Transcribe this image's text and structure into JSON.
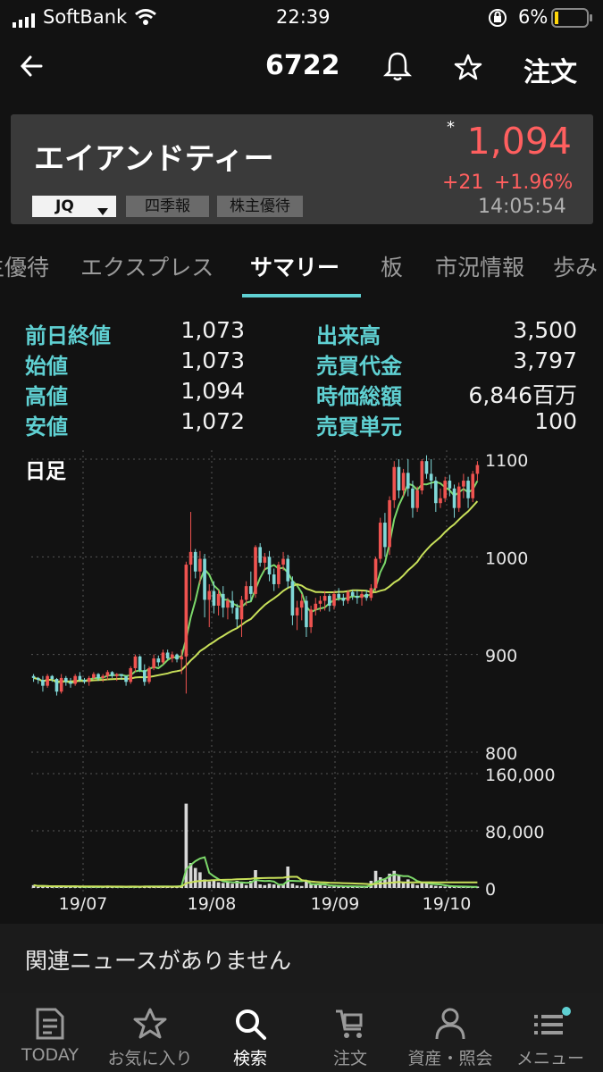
{
  "status_bar": {
    "carrier": "SoftBank",
    "time": "22:39",
    "battery": "6%"
  },
  "nav": {
    "back_icon": "arrow-left-icon",
    "title": "6722",
    "bell_icon": "bell-icon",
    "star_icon": "star-icon",
    "order_label": "注文"
  },
  "quote": {
    "name": "エイアンドティー",
    "asterisk": "*",
    "price": "1,094",
    "change": "+21",
    "change_pct": "+1.96%",
    "time": "14:05:54",
    "market": "JQ",
    "tags": [
      "四季報",
      "株主優待"
    ],
    "price_color": "#ff5f5f"
  },
  "tabs": [
    "主優待",
    "エクスプレス",
    "サマリー",
    "板",
    "市況情報",
    "歩み"
  ],
  "active_tab": "サマリー",
  "stats": {
    "left": [
      {
        "label": "前日終値",
        "value": "1,073"
      },
      {
        "label": "始値",
        "value": "1,073"
      },
      {
        "label": "高値",
        "value": "1,094"
      },
      {
        "label": "安値",
        "value": "1,072"
      }
    ],
    "right": [
      {
        "label": "出来高",
        "value": "3,500"
      },
      {
        "label": "売買代金",
        "value": "3,797"
      },
      {
        "label": "時価総額",
        "value": "6,846百万"
      },
      {
        "label": "売買単元",
        "value": "100"
      }
    ]
  },
  "chart_data": {
    "type": "candlestick",
    "period_label": "日足",
    "price_axis": {
      "ticks": [
        "1100",
        "1000",
        "900",
        "800"
      ],
      "ylim": [
        800,
        1100
      ]
    },
    "volume_axis": {
      "ticks": [
        "160,000",
        "80,000",
        "0"
      ],
      "ylim": [
        0,
        160000
      ]
    },
    "x_ticks": [
      "19/07",
      "19/08",
      "19/09",
      "19/10"
    ],
    "colors": {
      "up": "#ef5350",
      "down": "#80d8d8",
      "ma_short": "#7cd86a",
      "ma_mid": "#c8e05a",
      "ma_long": "#e070c0"
    },
    "candles": [
      [
        878,
        880,
        872,
        876
      ],
      [
        876,
        877,
        870,
        874
      ],
      [
        874,
        878,
        862,
        868
      ],
      [
        868,
        880,
        866,
        878
      ],
      [
        878,
        879,
        872,
        875
      ],
      [
        875,
        876,
        858,
        862
      ],
      [
        862,
        880,
        860,
        876
      ],
      [
        876,
        878,
        868,
        872
      ],
      [
        872,
        876,
        866,
        870
      ],
      [
        870,
        880,
        868,
        878
      ],
      [
        878,
        882,
        872,
        874
      ],
      [
        874,
        876,
        870,
        872
      ],
      [
        872,
        878,
        868,
        876
      ],
      [
        876,
        882,
        874,
        880
      ],
      [
        880,
        881,
        873,
        876
      ],
      [
        876,
        880,
        872,
        878
      ],
      [
        878,
        884,
        874,
        882
      ],
      [
        882,
        883,
        876,
        878
      ],
      [
        878,
        881,
        873,
        880
      ],
      [
        880,
        879,
        874,
        878
      ],
      [
        878,
        876,
        868,
        872
      ],
      [
        872,
        888,
        870,
        886
      ],
      [
        886,
        900,
        882,
        898
      ],
      [
        898,
        899,
        882,
        884
      ],
      [
        884,
        890,
        868,
        872
      ],
      [
        872,
        888,
        870,
        886
      ],
      [
        886,
        900,
        884,
        896
      ],
      [
        896,
        899,
        888,
        892
      ],
      [
        892,
        905,
        890,
        902
      ],
      [
        902,
        905,
        895,
        896
      ],
      [
        896,
        903,
        892,
        900
      ],
      [
        900,
        901,
        892,
        895
      ],
      [
        895,
        905,
        880,
        898
      ],
      [
        898,
        995,
        860,
        992
      ],
      [
        992,
        1046,
        955,
        1005
      ],
      [
        1005,
        1008,
        978,
        985
      ],
      [
        985,
        1006,
        972,
        998
      ],
      [
        998,
        1003,
        938,
        956
      ],
      [
        956,
        972,
        928,
        965
      ],
      [
        965,
        975,
        942,
        950
      ],
      [
        950,
        966,
        940,
        962
      ],
      [
        962,
        970,
        938,
        948
      ],
      [
        948,
        958,
        936,
        955
      ],
      [
        955,
        965,
        942,
        948
      ],
      [
        948,
        952,
        928,
        936
      ],
      [
        936,
        960,
        918,
        956
      ],
      [
        956,
        975,
        950,
        970
      ],
      [
        970,
        985,
        955,
        962
      ],
      [
        962,
        1012,
        958,
        1010
      ],
      [
        1010,
        1014,
        990,
        994
      ],
      [
        994,
        1004,
        986,
        1000
      ],
      [
        1000,
        1006,
        975,
        982
      ],
      [
        982,
        988,
        965,
        972
      ],
      [
        972,
        995,
        968,
        992
      ],
      [
        992,
        1005,
        986,
        998
      ],
      [
        998,
        1002,
        968,
        975
      ],
      [
        975,
        980,
        930,
        940
      ],
      [
        940,
        955,
        925,
        948
      ],
      [
        948,
        962,
        935,
        955
      ],
      [
        955,
        960,
        918,
        928
      ],
      [
        928,
        950,
        922,
        946
      ],
      [
        946,
        958,
        940,
        952
      ],
      [
        952,
        960,
        944,
        955
      ],
      [
        955,
        965,
        945,
        960
      ],
      [
        960,
        962,
        944,
        950
      ],
      [
        950,
        965,
        946,
        962
      ],
      [
        962,
        968,
        955,
        958
      ],
      [
        958,
        962,
        950,
        955
      ],
      [
        955,
        966,
        952,
        964
      ],
      [
        964,
        966,
        956,
        960
      ],
      [
        960,
        966,
        952,
        958
      ],
      [
        958,
        965,
        950,
        962
      ],
      [
        962,
        966,
        955,
        958
      ],
      [
        958,
        972,
        955,
        968
      ],
      [
        968,
        1000,
        965,
        998
      ],
      [
        998,
        1040,
        994,
        1035
      ],
      [
        1035,
        1045,
        1000,
        1010
      ],
      [
        1010,
        1062,
        1002,
        1058
      ],
      [
        1058,
        1098,
        1050,
        1092
      ],
      [
        1092,
        1100,
        1060,
        1068
      ],
      [
        1068,
        1090,
        1062,
        1086
      ],
      [
        1086,
        1100,
        1062,
        1070
      ],
      [
        1070,
        1078,
        1040,
        1050
      ],
      [
        1050,
        1072,
        1046,
        1068
      ],
      [
        1068,
        1100,
        1064,
        1098
      ],
      [
        1098,
        1104,
        1080,
        1085
      ],
      [
        1085,
        1100,
        1070,
        1078
      ],
      [
        1078,
        1082,
        1046,
        1055
      ],
      [
        1055,
        1070,
        1050,
        1060
      ],
      [
        1060,
        1082,
        1056,
        1078
      ],
      [
        1078,
        1084,
        1062,
        1070
      ],
      [
        1070,
        1074,
        1040,
        1050
      ],
      [
        1050,
        1076,
        1046,
        1072
      ],
      [
        1072,
        1085,
        1060,
        1078
      ],
      [
        1078,
        1082,
        1050,
        1060
      ],
      [
        1060,
        1088,
        1056,
        1085
      ],
      [
        1085,
        1098,
        1078,
        1094
      ]
    ],
    "volume": [
      4000,
      1500,
      3000,
      2000,
      1200,
      3500,
      2500,
      1500,
      1800,
      2500,
      1200,
      1000,
      2000,
      2200,
      1500,
      1500,
      2500,
      1200,
      1500,
      1000,
      1200,
      2500,
      2000,
      1500,
      3000,
      2500,
      2000,
      1500,
      2500,
      2000,
      2000,
      3000,
      3500,
      118000,
      35000,
      28000,
      22000,
      12000,
      9000,
      11000,
      8000,
      7000,
      8000,
      6000,
      10000,
      8000,
      4000,
      10000,
      25000,
      5000,
      4000,
      6000,
      5000,
      4000,
      5000,
      30000,
      6000,
      3500,
      2800,
      10000,
      5000,
      4000,
      4000,
      3000,
      2000,
      2500,
      3000,
      2000,
      2500,
      2000,
      1500,
      2000,
      1500,
      10000,
      24000,
      15000,
      12000,
      20000,
      24000,
      18000,
      9000,
      12000,
      6000,
      4000,
      8000,
      7000,
      4000,
      3000,
      2500,
      2000,
      2500,
      2000,
      1500,
      2000,
      1500,
      1200,
      2000
    ]
  },
  "news": {
    "text": "関連ニュースがありません"
  },
  "tab_bar": [
    {
      "label": "TODAY",
      "icon": "news-icon"
    },
    {
      "label": "お気に入り",
      "icon": "star-icon"
    },
    {
      "label": "検索",
      "icon": "search-icon"
    },
    {
      "label": "注文",
      "icon": "cart-icon"
    },
    {
      "label": "資産・照会",
      "icon": "person-icon"
    },
    {
      "label": "メニュー",
      "icon": "menu-icon"
    }
  ],
  "active_tab_bar": "検索"
}
